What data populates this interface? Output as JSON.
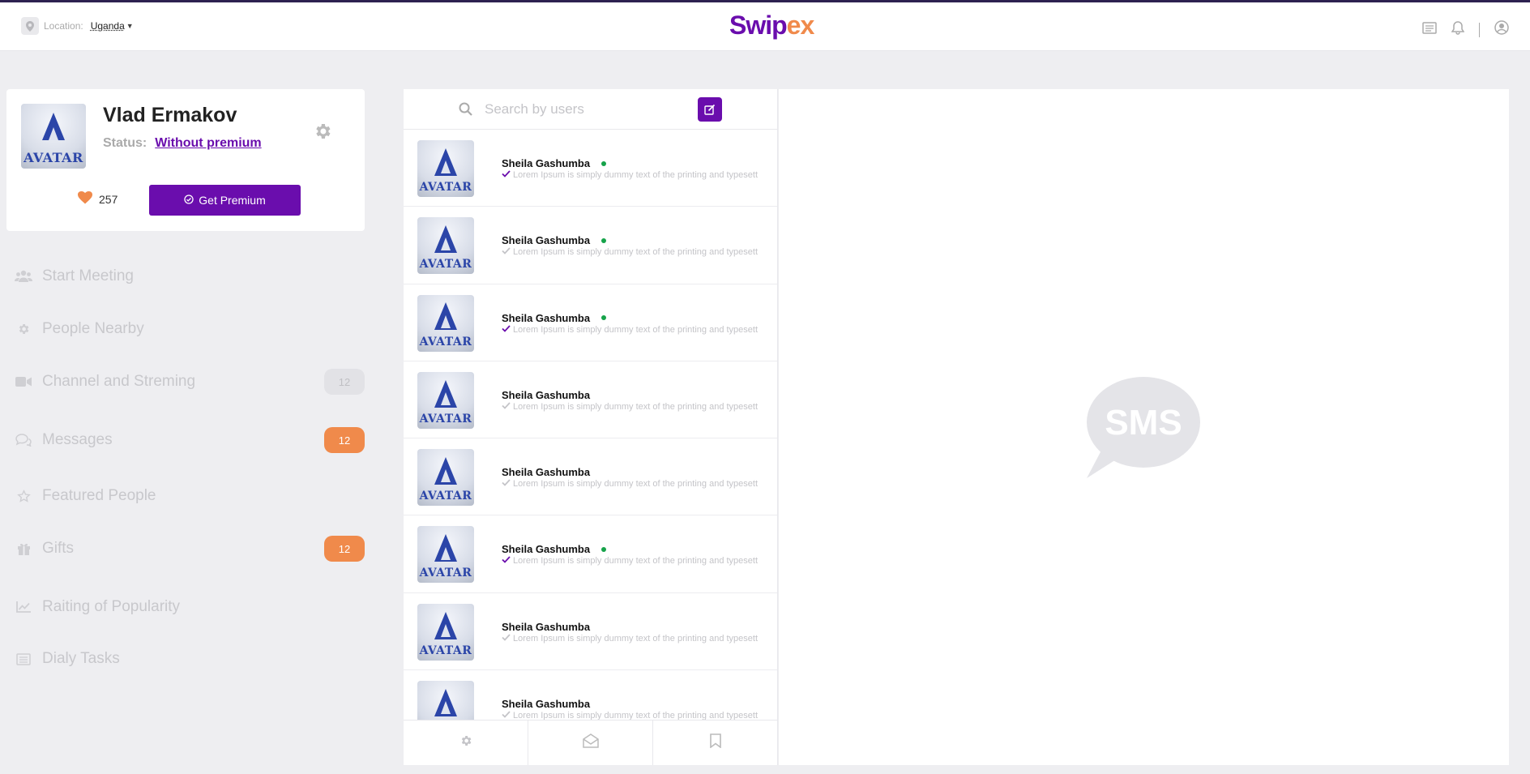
{
  "header": {
    "location_label": "Location:",
    "location_value": "Uganda",
    "logo_part1": "Swip",
    "logo_part2": "ex"
  },
  "profile": {
    "name": "Vlad Ermakov",
    "status_label": "Status:",
    "status_value": "Without premium",
    "likes": "257",
    "premium_button": "Get Premium",
    "avatar_text": "AVATAR"
  },
  "menu": [
    {
      "label": "Start Meeting",
      "icon": "users-icon",
      "badge": ""
    },
    {
      "label": "People Nearby",
      "icon": "gear-icon",
      "badge": ""
    },
    {
      "label": "Channel and Streming",
      "icon": "video-camera-icon",
      "badge": "12",
      "badge_style": "grey"
    },
    {
      "label": "Messages",
      "icon": "chat-bubbles-icon",
      "badge": "12",
      "badge_style": "orange"
    },
    {
      "label": "Featured People",
      "icon": "star-icon",
      "badge": ""
    },
    {
      "label": "Gifts",
      "icon": "gift-icon",
      "badge": "12",
      "badge_style": "orange"
    },
    {
      "label": "Raiting of Popularity",
      "icon": "chart-line-icon",
      "badge": ""
    },
    {
      "label": "Dialy Tasks",
      "icon": "list-icon",
      "badge": ""
    }
  ],
  "search": {
    "placeholder": "Search by users"
  },
  "conversations": [
    {
      "name": "Sheila Gashumba",
      "online": true,
      "read": true,
      "message": "Lorem Ipsum is simply dummy text of the printing and typesett",
      "avatar_text": "AVATAR"
    },
    {
      "name": "Sheila Gashumba",
      "online": true,
      "read": false,
      "message": "Lorem Ipsum is simply dummy text of the printing and typesett",
      "avatar_text": "AVATAR"
    },
    {
      "name": "Sheila Gashumba",
      "online": true,
      "read": true,
      "message": "Lorem Ipsum is simply dummy text of the printing and typesett",
      "avatar_text": "AVATAR"
    },
    {
      "name": "Sheila Gashumba",
      "online": false,
      "read": false,
      "message": "Lorem Ipsum is simply dummy text of the printing and typesett",
      "avatar_text": "AVATAR"
    },
    {
      "name": "Sheila Gashumba",
      "online": false,
      "read": false,
      "message": "Lorem Ipsum is simply dummy text of the printing and typesett",
      "avatar_text": "AVATAR"
    },
    {
      "name": "Sheila Gashumba",
      "online": true,
      "read": true,
      "message": "Lorem Ipsum is simply dummy text of the printing and typesett",
      "avatar_text": "AVATAR"
    },
    {
      "name": "Sheila Gashumba",
      "online": false,
      "read": false,
      "message": "Lorem Ipsum is simply dummy text of the printing and typesett",
      "avatar_text": "AVATAR"
    },
    {
      "name": "Sheila Gashumba",
      "online": false,
      "read": false,
      "message": "Lorem Ipsum is simply dummy text of the printing and typesett",
      "avatar_text": "AVATAR"
    }
  ],
  "tabs": [
    {
      "icon": "gear-icon"
    },
    {
      "icon": "envelope-open-icon"
    },
    {
      "icon": "bookmark-icon"
    }
  ],
  "chat": {
    "placeholder_icon_text": "SMS"
  },
  "colors": {
    "brand_purple": "#6a0dad",
    "brand_orange": "#f08a4b",
    "online_green": "#16a34a"
  }
}
